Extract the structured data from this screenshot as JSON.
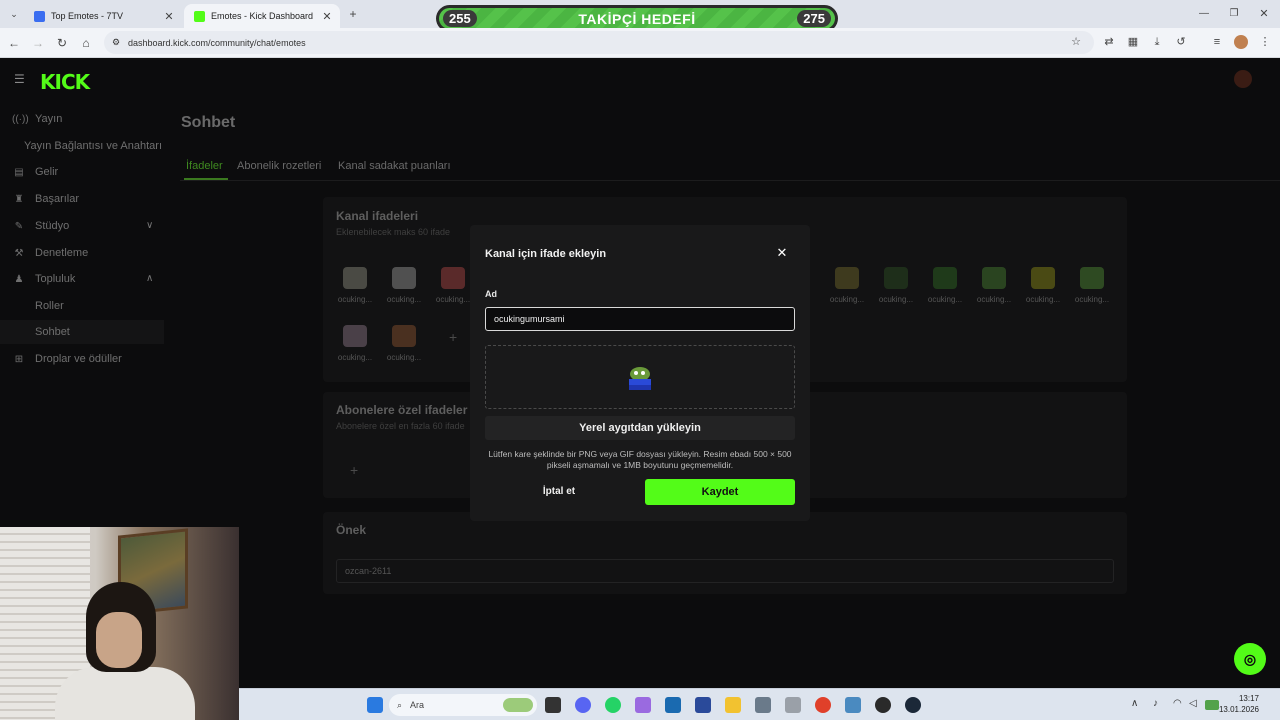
{
  "browser": {
    "tabs": [
      {
        "title": "Top Emotes - 7TV",
        "active": false
      },
      {
        "title": "Emotes - Kick Dashboard",
        "active": true
      }
    ],
    "url": "dashboard.kick.com/community/chat/emotes"
  },
  "goal_overlay": {
    "title": "TAKİPÇİ HEDEFİ",
    "current": "255",
    "target": "275"
  },
  "sidebar": {
    "items": [
      {
        "label": "Yayın",
        "icon": "broadcast-icon"
      },
      {
        "label": "Yayın Bağlantısı ve Anahtarı",
        "icon": ""
      },
      {
        "label": "Gelir",
        "icon": "wallet-icon"
      },
      {
        "label": "Başarılar",
        "icon": "trophy-icon"
      },
      {
        "label": "Stüdyo",
        "icon": "studio-icon"
      },
      {
        "label": "Denetleme",
        "icon": "hammer-icon"
      },
      {
        "label": "Topluluk",
        "icon": "community-icon"
      },
      {
        "label": "Roller",
        "icon": ""
      },
      {
        "label": "Sohbet",
        "icon": ""
      },
      {
        "label": "Droplar ve ödüller",
        "icon": "gift-icon"
      }
    ]
  },
  "main": {
    "title": "Sohbet",
    "tabs": [
      "İfadeler",
      "Abonelik rozetleri",
      "Kanal sadakat puanları"
    ],
    "channel_emotes": {
      "title": "Kanal ifadeleri",
      "subtitle": "Eklenebilecek maks 60 ifade",
      "emote_label": "ocuking..."
    },
    "sub_emotes": {
      "title": "Abonelere özel ifadeler",
      "subtitle": "Abonelere özel en fazla 60 ifade"
    },
    "prefix": {
      "title": "Önek",
      "value": "ozcan-2611"
    }
  },
  "modal": {
    "title": "Kanal için ifade ekleyin",
    "field_label": "Ad",
    "name_value": "ocukingumursami",
    "upload_label": "Yerel aygıtdan yükleyin",
    "hint": "Lütfen kare şeklinde bir PNG veya GIF dosyası yükleyin. Resim ebadı 500 × 500 pikseli aşmamalı ve 1MB boyutunu geçmemelidir.",
    "cancel_label": "İptal et",
    "save_label": "Kaydet"
  },
  "taskbar": {
    "search_placeholder": "Ara",
    "time": "13:17",
    "date": "13.01.2026"
  },
  "colors": {
    "brand": "#53fc18",
    "modal_bg": "#19191a",
    "page_bg": "#0c0c0d"
  }
}
